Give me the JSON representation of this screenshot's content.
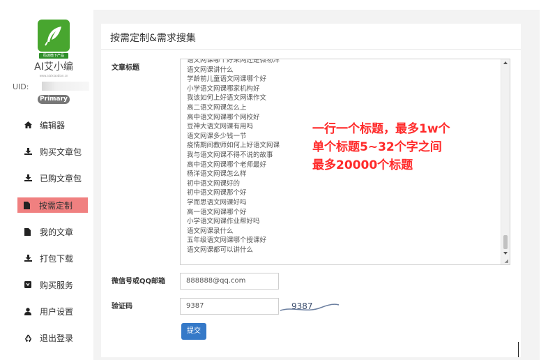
{
  "sidebar": {
    "logo_tag": "码迷微下产品",
    "brand": "AI艾小编",
    "brand_url": "www.aiaixiaobian.cn",
    "uid_label": "UID:",
    "badge": "Primary",
    "menu": [
      {
        "label": "编辑器",
        "icon": "home-icon"
      },
      {
        "label": "购买文章包",
        "icon": "download-icon"
      },
      {
        "label": "已购文章包",
        "icon": "download-icon"
      },
      {
        "label": "按需定制",
        "icon": "file-icon",
        "active": true
      },
      {
        "label": "我的文章",
        "icon": "file-icon"
      },
      {
        "label": "打包下载",
        "icon": "download-icon"
      },
      {
        "label": "购买服务",
        "icon": "shop-icon"
      },
      {
        "label": "用户设置",
        "icon": "user-icon"
      },
      {
        "label": "退出登录",
        "icon": "recycle-icon"
      }
    ]
  },
  "main": {
    "title": "按需定制&需求搜集",
    "form": {
      "article_title_label": "文章标题",
      "titles": [
        "语文网课哪个好呆网还是微物洋",
        "语文网课讲什么",
        "学龄前儿童语文网课哪个好",
        "小学语文网课哪家机构好",
        "我该如何上好语文网课作文",
        "高二语文网课怎么上",
        "高中语文网课哪个网校好",
        "豆神大语文网课有用吗",
        "语文网课多少钱一节",
        "疫情期间教师如何上好语文网课",
        "我与语文网课不得不说的故事",
        "高中语文网课哪个老师最好",
        "杨洋语文网课怎么样",
        "初中语文网课好的",
        "初中语文网课那个好",
        "学而思语文网课好吗",
        "高一语文网课哪个好",
        "小学语文网课作业帮好吗",
        "语文网课录什么",
        "五年级语文网课哪个授课好",
        "语文网课都可以讲什么"
      ],
      "note_lines": [
        "一行一个标题，最多1w个",
        "单个标题5~32个字之间",
        "最多20000个标题"
      ],
      "contact_label": "微信号或QQ邮箱",
      "contact_value": "888888@qq.com",
      "captcha_label": "验证码",
      "captcha_value": "9387",
      "captcha_image_text": "9387",
      "submit_label": "提交"
    }
  },
  "colors": {
    "accent": "#3579c8",
    "active_menu": "#f08080",
    "note_red": "#ff2a2a",
    "logo_green": "#48a62f"
  }
}
